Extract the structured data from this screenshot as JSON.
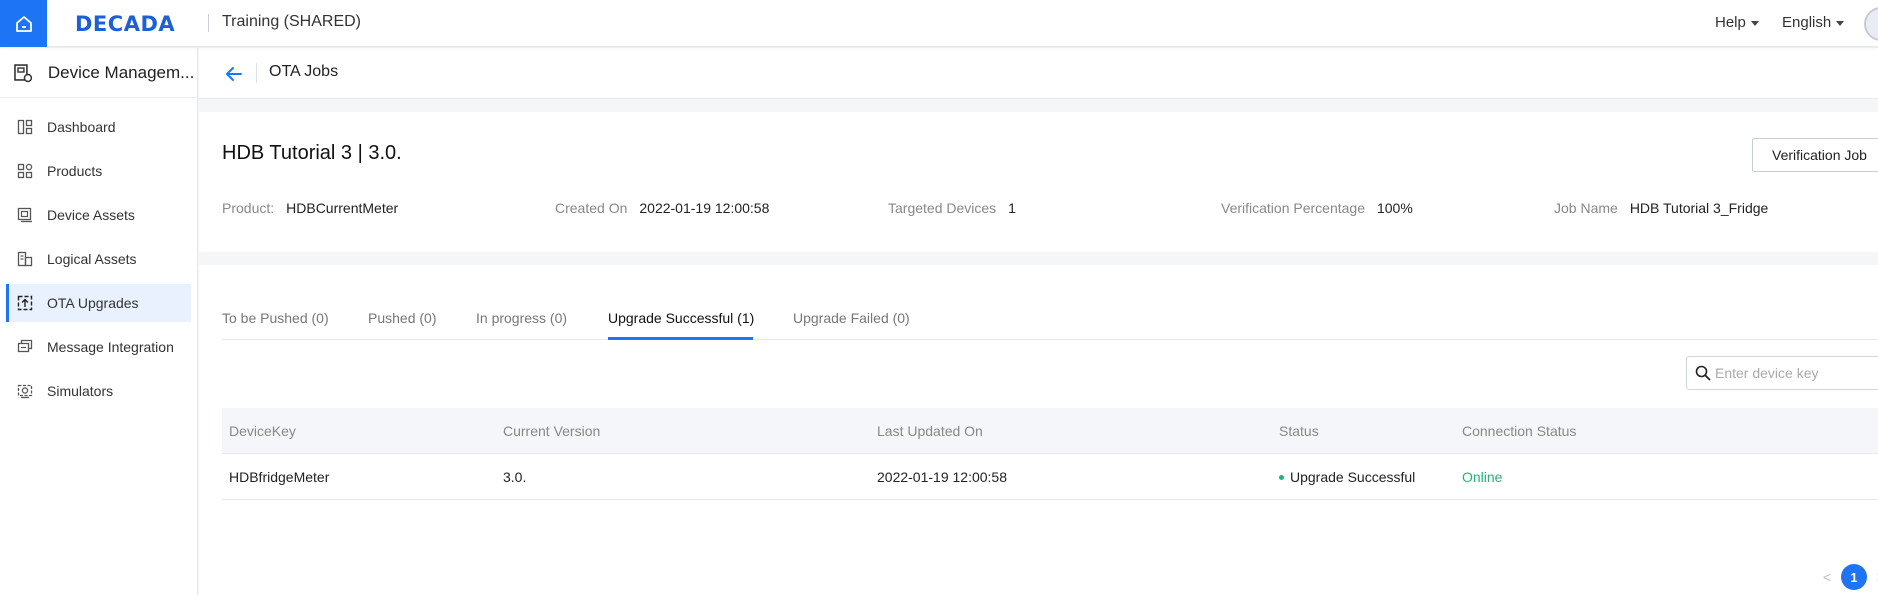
{
  "topbar": {
    "logo": "DECADA",
    "workspace": "Training (SHARED)",
    "help": "Help",
    "language": "English"
  },
  "sidebar": {
    "title": "Device Managem...",
    "items": [
      {
        "label": "Dashboard",
        "icon": "dashboard-icon"
      },
      {
        "label": "Products",
        "icon": "products-icon"
      },
      {
        "label": "Device Assets",
        "icon": "device-assets-icon"
      },
      {
        "label": "Logical Assets",
        "icon": "logical-assets-icon"
      },
      {
        "label": "OTA Upgrades",
        "icon": "ota-upgrades-icon",
        "active": true
      },
      {
        "label": "Message Integration",
        "icon": "message-integration-icon"
      },
      {
        "label": "Simulators",
        "icon": "simulators-icon"
      }
    ]
  },
  "subheader": {
    "title": "OTA Jobs"
  },
  "job": {
    "title": "HDB Tutorial 3 | 3.0.",
    "verify_button": "Verification Job",
    "meta": {
      "product_label": "Product:",
      "product": "HDBCurrentMeter",
      "created_label": "Created On",
      "created": "2022-01-19 12:00:58",
      "targeted_label": "Targeted Devices",
      "targeted": "1",
      "percentage_label": "Verification Percentage",
      "percentage": "100%",
      "jobname_label": "Job Name",
      "jobname": "HDB Tutorial 3_Fridge"
    }
  },
  "tabs": [
    {
      "label": "To be Pushed (0)"
    },
    {
      "label": "Pushed (0)"
    },
    {
      "label": "In progress (0)"
    },
    {
      "label": "Upgrade Successful (1)",
      "active": true
    },
    {
      "label": "Upgrade Failed (0)"
    }
  ],
  "search": {
    "placeholder": "Enter device key"
  },
  "table": {
    "columns": [
      "DeviceKey",
      "Current Version",
      "Last Updated On",
      "Status",
      "Connection Status"
    ],
    "rows": [
      {
        "device_key": "HDBfridgeMeter",
        "version": "3.0.",
        "updated": "2022-01-19 12:00:58",
        "status": "Upgrade Successful",
        "connection": "Online"
      }
    ]
  },
  "pagination": {
    "current": "1",
    "prev": "<",
    "next": ">"
  },
  "colors": {
    "accent": "#1d74f5",
    "success": "#22b573"
  }
}
